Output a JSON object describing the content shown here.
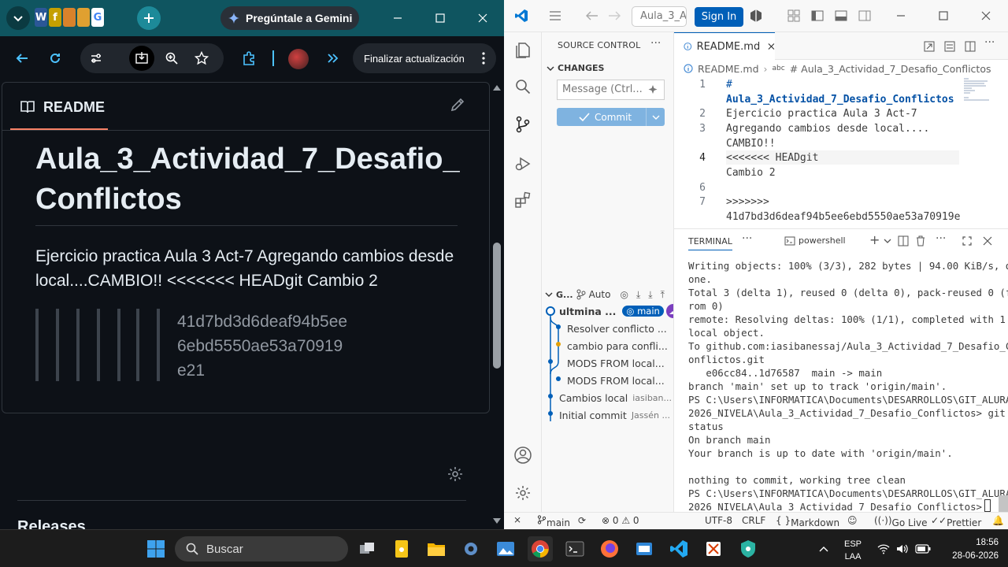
{
  "browser": {
    "tabs": {
      "gemini_label": "Pregúntale a Gemini",
      "favicons": [
        "W",
        "f",
        "",
        "",
        "G"
      ]
    },
    "toolbar": {
      "update_button": "Finalizar actualización"
    },
    "readme": {
      "tab_label": "README",
      "title": "Aula_3_Actividad_7_Desafio_Conflictos",
      "paragraph": "Ejercicio practica Aula 3 Act-7 Agregando cambios desde local....CAMBIO!! <<<<<<< HEADgit Cambio 2",
      "quote_hash": "41d7bd3d6deaf94b5ee6ebd5550ae53a70919e21",
      "next_section": "Releases"
    }
  },
  "vscode": {
    "title_search": "Aula_3_A",
    "signin_label": "Sign In",
    "scm": {
      "header": "SOURCE CONTROL",
      "changes": "CHANGES",
      "message_placeholder": "Message (Ctrl...",
      "commit_label": "Commit",
      "graph_header": "G...",
      "graph_auto": "Auto",
      "graph_rows": [
        {
          "label": "ultmina ...",
          "badge": "main"
        },
        {
          "label": "Resolver conflicto ..."
        },
        {
          "label": "cambio para confli..."
        },
        {
          "label": "MODS FROM local..."
        },
        {
          "label": "MODS FROM local..."
        },
        {
          "label": "Cambios local",
          "author": "iasiban..."
        },
        {
          "label": "Initial commit",
          "author": "Jassén ..."
        }
      ]
    },
    "editor": {
      "tab_label": "README.md",
      "breadcrumb_file": "README.md",
      "breadcrumb_symbol": "# Aula_3_Actividad_7_Desafio_Conflictos",
      "lines": [
        {
          "n": "1",
          "text": "#"
        },
        {
          "n": "",
          "text": "Aula_3_Actividad_7_Desafio_Conflictos"
        },
        {
          "n": "2",
          "text": "Ejercicio practica Aula 3 Act-7"
        },
        {
          "n": "3",
          "text": "Agregando cambios desde local...."
        },
        {
          "n": "",
          "text": "CAMBIO!!"
        },
        {
          "n": "4",
          "text": "<<<<<<< HEADgit"
        },
        {
          "n": "",
          "text": "Cambio 2"
        },
        {
          "n": "6",
          "text": ""
        },
        {
          "n": "7",
          "text": ">>>>>>>"
        },
        {
          "n": "",
          "text": "41d7bd3d6deaf94b5ee6ebd5550ae53a70919e"
        }
      ]
    },
    "terminal": {
      "tab_label": "TERMINAL",
      "shell": "powershell",
      "output": "Writing objects: 100% (3/3), 282 bytes | 94.00 KiB/s, d\none.\nTotal 3 (delta 1), reused 0 (delta 0), pack-reused 0 (f\nrom 0)\nremote: Resolving deltas: 100% (1/1), completed with 1\nlocal object.\nTo github.com:iasibanessaj/Aula_3_Actividad_7_Desafio_C\nonflictos.git\n   e06cc84..1d76587  main -> main\nbranch 'main' set up to track 'origin/main'.\nPS C:\\Users\\INFORMATICA\\Documents\\DESARROLLOS\\GIT_ALURA\n2026_NIVELA\\Aula_3_Actividad_7_Desafio_Conflictos> git\nstatus\nOn branch main\nYour branch is up to date with 'origin/main'.\n\nnothing to commit, working tree clean\nPS C:\\Users\\INFORMATICA\\Documents\\DESARROLLOS\\GIT_ALURA\n2026_NIVELA\\Aula_3_Actividad_7_Desafio_Conflictos> "
    },
    "statusbar": {
      "branch": "main",
      "problems": "⊗ 0 ⚠ 0",
      "encoding": "UTF-8",
      "eol": "CRLF",
      "language": "Markdown",
      "golive": "Go Live",
      "prettier": "Prettier"
    }
  },
  "taskbar": {
    "search_label": "Buscar",
    "lang_top": "ESP",
    "lang_bottom": "LAA",
    "time": "18:56",
    "date": "28-06-2026"
  },
  "colors": {
    "accent_teal": "#0f5560",
    "vscode_blue": "#005fb8",
    "github_dark": "#0d1117"
  }
}
